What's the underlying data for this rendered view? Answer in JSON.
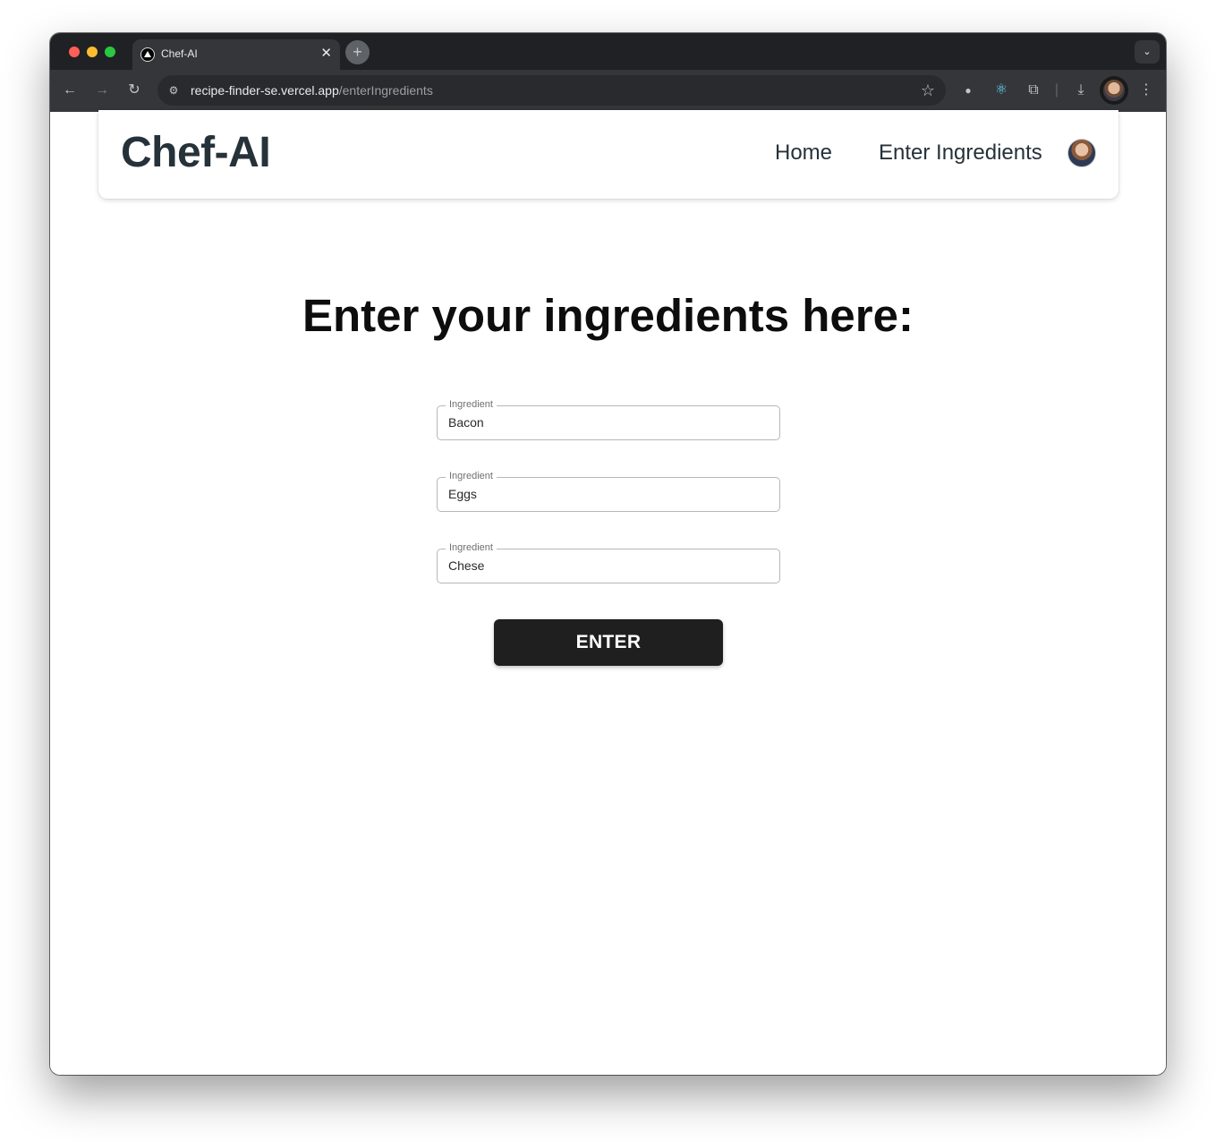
{
  "browser": {
    "tab_title": "Chef-AI",
    "tab_close_icon": "close-icon",
    "new_tab_symbol": "+",
    "url_host": "recipe-finder-se.vercel.app",
    "url_path": "/enterIngredients"
  },
  "nav": {
    "brand": "Chef-AI",
    "home_label": "Home",
    "enter_label": "Enter Ingredients"
  },
  "main": {
    "heading": "Enter your ingredients here:",
    "fields": [
      {
        "label": "Ingredient",
        "value": "Bacon"
      },
      {
        "label": "Ingredient",
        "value": "Eggs"
      },
      {
        "label": "Ingredient",
        "value": "Chese"
      }
    ],
    "enter_button": "ENTER"
  },
  "colors": {
    "brand_text": "#26323a",
    "button_bg": "#1f1f1f",
    "browser_chrome": "#35363a"
  }
}
